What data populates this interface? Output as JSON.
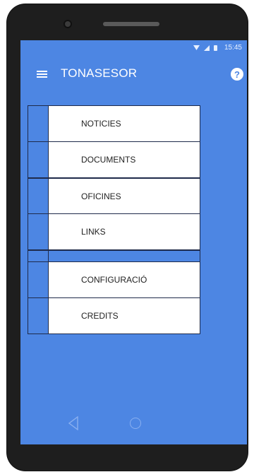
{
  "status_bar": {
    "time": "15:45"
  },
  "app_bar": {
    "title": "TONASESOR",
    "help_symbol": "?"
  },
  "menu": {
    "items": [
      {
        "label": "NOTICIES"
      },
      {
        "label": "DOCUMENTS"
      },
      {
        "label": "OFICINES"
      },
      {
        "label": "LINKS"
      },
      {
        "label": "CONFIGURACIÓ"
      },
      {
        "label": "CREDITS"
      }
    ]
  },
  "icons": {
    "menu": "hamburger-icon",
    "help": "question-icon",
    "back": "triangle-back-icon",
    "home": "circle-home-icon"
  },
  "colors": {
    "primary": "#4d86e3",
    "item_background": "#ffffff",
    "item_text": "#222222"
  }
}
